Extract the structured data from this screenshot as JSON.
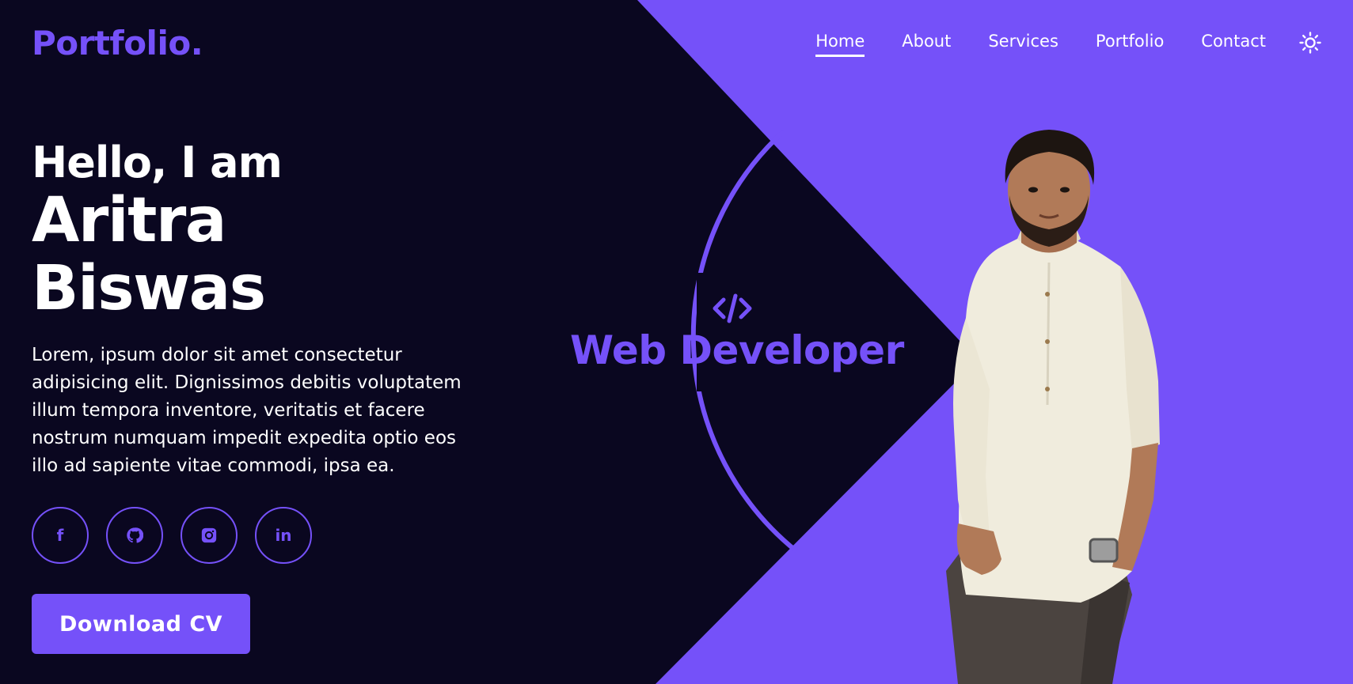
{
  "brand": {
    "logo_text": "Portfolio."
  },
  "nav": {
    "items": [
      {
        "label": "Home",
        "active": true
      },
      {
        "label": "About"
      },
      {
        "label": "Services"
      },
      {
        "label": "Portfolio"
      },
      {
        "label": "Contact"
      }
    ],
    "theme_toggle_icon": "sun-icon"
  },
  "hero": {
    "greeting": "Hello, I am",
    "name": "Aritra Biswas",
    "description": "Lorem, ipsum dolor sit amet consectetur adipisicing elit. Dignissimos debitis voluptatem illum tempora inventore, veritatis et facere nostrum numquam impedit expedita optio eos illo ad sapiente vitae commodi, ipsa ea.",
    "socials": [
      {
        "icon": "facebook-icon",
        "glyph": "f"
      },
      {
        "icon": "github-icon"
      },
      {
        "icon": "instagram-icon"
      },
      {
        "icon": "linkedin-icon",
        "glyph": "in"
      }
    ],
    "download_label": "Download CV"
  },
  "role": {
    "icon": "code-icon",
    "label": "Web Developer"
  },
  "colors": {
    "accent": "#7551f9",
    "background": "#0a0720",
    "text": "#ffffff"
  }
}
